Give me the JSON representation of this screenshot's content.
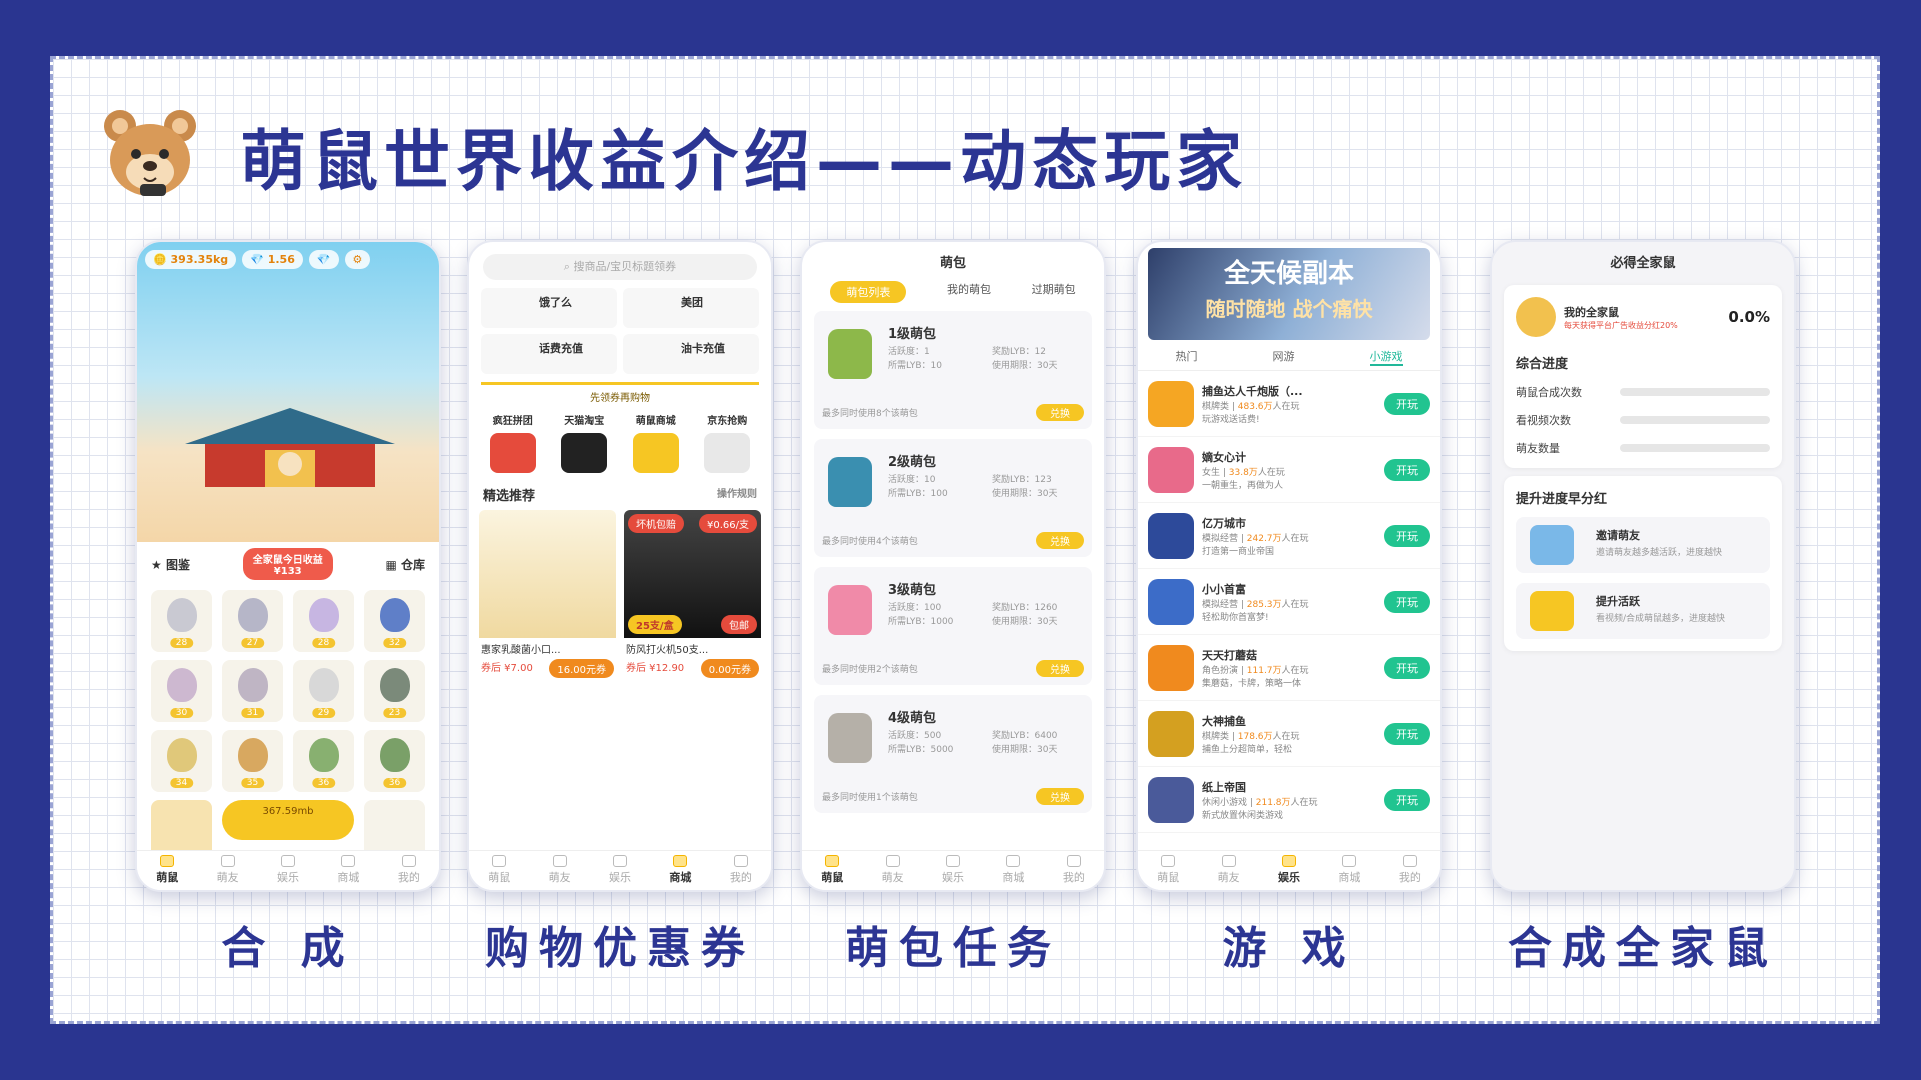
{
  "headline": "萌鼠世界收益介绍——动态玩家",
  "colors": {
    "brand": "#2c3593",
    "accent": "#f6c623",
    "play": "#21c490"
  },
  "captions": [
    "合 成",
    "购物优惠券",
    "萌包任务",
    "游 戏",
    "合成全家鼠"
  ],
  "phone1": {
    "coins": "393.35kg",
    "gems": "1.56",
    "left_label": "图鉴",
    "center_label": "全家鼠今日收益",
    "center_value": "¥133",
    "right_label": "仓库",
    "levels": [
      "28",
      "27",
      "28",
      "32",
      "30",
      "31",
      "29",
      "23",
      "34",
      "35",
      "36",
      "36"
    ],
    "buy_label": "367.59mb",
    "tabs": [
      "萌鼠",
      "萌友",
      "娱乐",
      "商城",
      "我的"
    ],
    "active_tab": 0
  },
  "phone2": {
    "search_placeholder": "搜商品/宝贝标题领券",
    "services": [
      "饿了么",
      "美团",
      "话费充值",
      "油卡充值"
    ],
    "banner": "先领券再购物",
    "shops": [
      "疯狂拼团",
      "天猫淘宝",
      "萌鼠商城",
      "京东抢购"
    ],
    "section_title": "精选推荐",
    "section_link": "操作规则",
    "products": [
      {
        "name": "惠家乳酸菌小口...",
        "price": "券后 ¥7.00",
        "coupon": "16.00元券"
      },
      {
        "name": "防风打火机50支...",
        "price": "券后 ¥12.90",
        "coupon": "0.00元券",
        "tag": "坏机包赔",
        "badge": "¥0.66/支",
        "promo": "25支/盒",
        "post": "包邮"
      }
    ],
    "tabs": [
      "萌鼠",
      "萌友",
      "娱乐",
      "商城",
      "我的"
    ],
    "active_tab": 3
  },
  "phone3": {
    "title": "萌包",
    "subtabs": [
      "萌包列表",
      "我的萌包",
      "过期萌包"
    ],
    "packs": [
      {
        "title": "1级萌包",
        "active": "活跃度：1",
        "need": "所需LYB：10",
        "reward": "奖励LYB：12",
        "period": "使用期限：30天",
        "limit": "最多同时使用8个该萌包"
      },
      {
        "title": "2级萌包",
        "active": "活跃度：10",
        "need": "所需LYB：100",
        "reward": "奖励LYB：123",
        "period": "使用期限：30天",
        "limit": "最多同时使用4个该萌包"
      },
      {
        "title": "3级萌包",
        "active": "活跃度：100",
        "need": "所需LYB：1000",
        "reward": "奖励LYB：1260",
        "period": "使用期限：30天",
        "limit": "最多同时使用2个该萌包"
      },
      {
        "title": "4级萌包",
        "active": "活跃度：500",
        "need": "所需LYB：5000",
        "reward": "奖励LYB：6400",
        "period": "使用期限：30天",
        "limit": "最多同时使用1个该萌包"
      }
    ],
    "exchange": "兑换",
    "tabs": [
      "萌鼠",
      "萌友",
      "娱乐",
      "商城",
      "我的"
    ],
    "active_tab": 0
  },
  "phone4": {
    "banner_title": "全天候副本",
    "banner_sub": "随时随地 战个痛快",
    "tabs_top": [
      "热门",
      "网游",
      "小游戏"
    ],
    "games": [
      {
        "name": "捕鱼达人千炮版（...",
        "players": "483.6万",
        "genre": "棋牌类",
        "desc": "玩游戏送话费!"
      },
      {
        "name": "嫡女心计",
        "players": "33.8万",
        "genre": "女生",
        "desc": "一朝重生，再做为人"
      },
      {
        "name": "亿万城市",
        "players": "242.7万",
        "genre": "模拟经营",
        "desc": "打造第一商业帝国"
      },
      {
        "name": "小小首富",
        "players": "285.3万",
        "genre": "模拟经营",
        "desc": "轻松助你首富梦!"
      },
      {
        "name": "天天打蘑菇",
        "players": "111.7万",
        "genre": "角色扮演",
        "desc": "集蘑菇，卡牌，策略一体"
      },
      {
        "name": "大神捕鱼",
        "players": "178.6万",
        "genre": "棋牌类",
        "desc": "捕鱼上分超简单，轻松"
      },
      {
        "name": "纸上帝国",
        "players": "211.8万",
        "genre": "休闲小游戏",
        "desc": "新式放置休闲类游戏"
      }
    ],
    "play_label": "开玩",
    "online_suffix": "人在玩",
    "tabs": [
      "萌鼠",
      "萌友",
      "娱乐",
      "商城",
      "我的"
    ],
    "active_tab": 2
  },
  "phone5": {
    "title": "必得全家鼠",
    "my_label": "我的全家鼠",
    "my_note": "每天获得平台广告收益分红20%",
    "percent": "0.0%",
    "progress_title": "综合进度",
    "progress_items": [
      "萌鼠合成次数",
      "看视频次数",
      "萌友数量"
    ],
    "boost_title": "提升进度早分红",
    "actions": [
      {
        "title": "邀请萌友",
        "desc": "邀请萌友越多越活跃，进度越快"
      },
      {
        "title": "提升活跃",
        "desc": "看视频/合成萌鼠越多，进度越快"
      }
    ]
  }
}
